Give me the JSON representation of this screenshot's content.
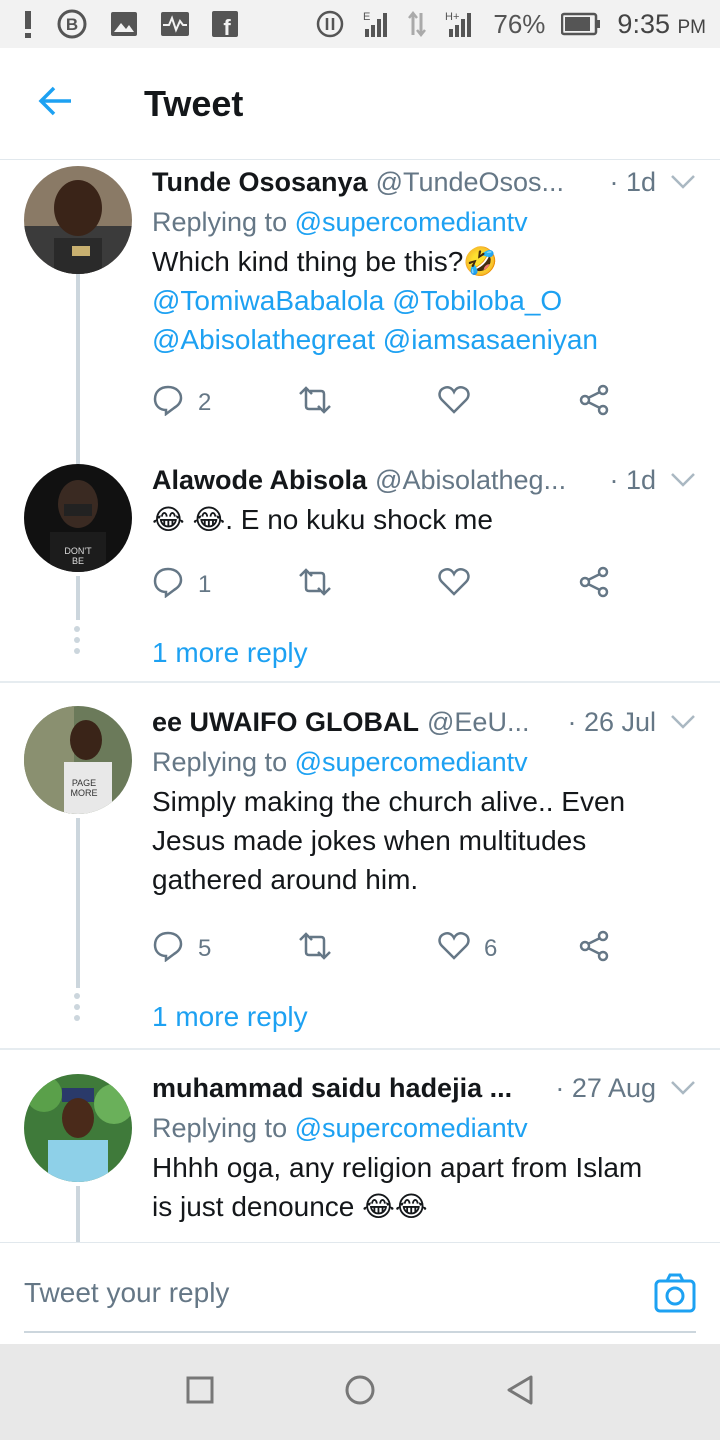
{
  "status_bar": {
    "battery": "76%",
    "time": "9:35",
    "ampm": "PM",
    "left_icons": [
      "alert-icon",
      "b-icon",
      "image-icon",
      "pulse-icon",
      "facebook-icon"
    ],
    "right_icons": [
      "sync-icon",
      "signal-e-icon",
      "data-arrows-icon",
      "signal-h-icon",
      "battery-icon"
    ]
  },
  "header": {
    "title": "Tweet",
    "back_icon": "back-arrow-icon"
  },
  "tweets": [
    {
      "name": "Tunde Ososanya",
      "handle": "@TundeOsos...",
      "time": "· 1d",
      "reply_prefix": "Replying to",
      "reply_to": "@supercomediantv",
      "text": "Which kind thing be this?🤣",
      "mentions_line1": "@TomiwaBabalola @Tobiloba_O",
      "mentions_line2": "@Abisolathegreat @iamsasaeniyan",
      "replies": "2",
      "retweets": "",
      "likes": ""
    },
    {
      "name": "Alawode Abisola",
      "handle": "@Abisolatheg...",
      "time": "· 1d",
      "text": "😂 😂. E no kuku shock me",
      "replies": "1",
      "retweets": "",
      "likes": "",
      "more_reply": "1 more reply"
    },
    {
      "name": "ee UWAIFO GLOBAL",
      "handle": "@EeU...",
      "time": "· 26 Jul",
      "reply_prefix": "Replying to",
      "reply_to": "@supercomediantv",
      "text_line1": "Simply making the church alive.. Even",
      "text_line2": "Jesus made jokes when multitudes",
      "text_line3": "gathered around him.",
      "replies": "5",
      "retweets": "",
      "likes": "6",
      "more_reply": "1 more reply"
    },
    {
      "name": "muhammad saidu hadejia ...",
      "handle": "",
      "time": "· 27 Aug",
      "reply_prefix": "Replying to",
      "reply_to": "@supercomediantv",
      "text_line1": "Hhhh oga, any religion apart from Islam",
      "text_line2": "is just denounce 😂😂"
    }
  ],
  "reply_box": {
    "placeholder": "Tweet your reply",
    "camera_icon": "camera-icon"
  },
  "nav_bar": {
    "icons": [
      "recents-square-icon",
      "home-circle-icon",
      "back-triangle-icon"
    ]
  },
  "colors": {
    "accent": "#1da1f2",
    "muted": "#657786",
    "text": "#14171a",
    "divider": "#e6ecf0"
  }
}
